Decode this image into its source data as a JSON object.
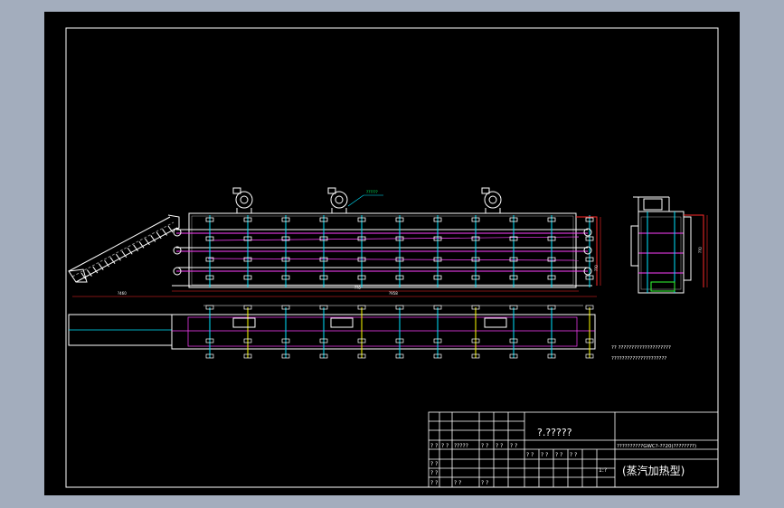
{
  "drawing": {
    "colors": {
      "outer_bg": "#a3adbd",
      "paper": "#000000",
      "frame": "#ffffff",
      "body": "#ffffff",
      "rail": "#00e5ff",
      "red": "#ff2a2a",
      "magenta": "#ff40ff",
      "yellow": "#ffff00",
      "green": "#33ff33"
    },
    "annotation_callout": "??????",
    "dim_left": "?460",
    "dim_mid_top": "??0",
    "dim_mid_bottom": "?958",
    "dim_right": "??0",
    "dim_side_height": "??0",
    "note_line1": "?? ????????????????????",
    "note_line2": "?????????????????????",
    "title_block": {
      "project_name": "?.?????",
      "description": "??????????GWC?-??20(????????)",
      "subtitle": "(蒸汽加热型)",
      "sheet_ref": "1:?",
      "cells": {
        "r1c1": "? ?",
        "r1c2": "? ?",
        "r1c3": "?????",
        "r1c4": "? ?",
        "r1c5": "? ?",
        "r1c6": "? ?",
        "r2c1": "? ?",
        "r2c2": "? ?",
        "r3c1": "? ?",
        "r3c2": "? ?",
        "r3c3": "? ?",
        "s1": "? ?",
        "s2": "? ?",
        "s3": "? ?",
        "s4": "? ?"
      }
    }
  }
}
